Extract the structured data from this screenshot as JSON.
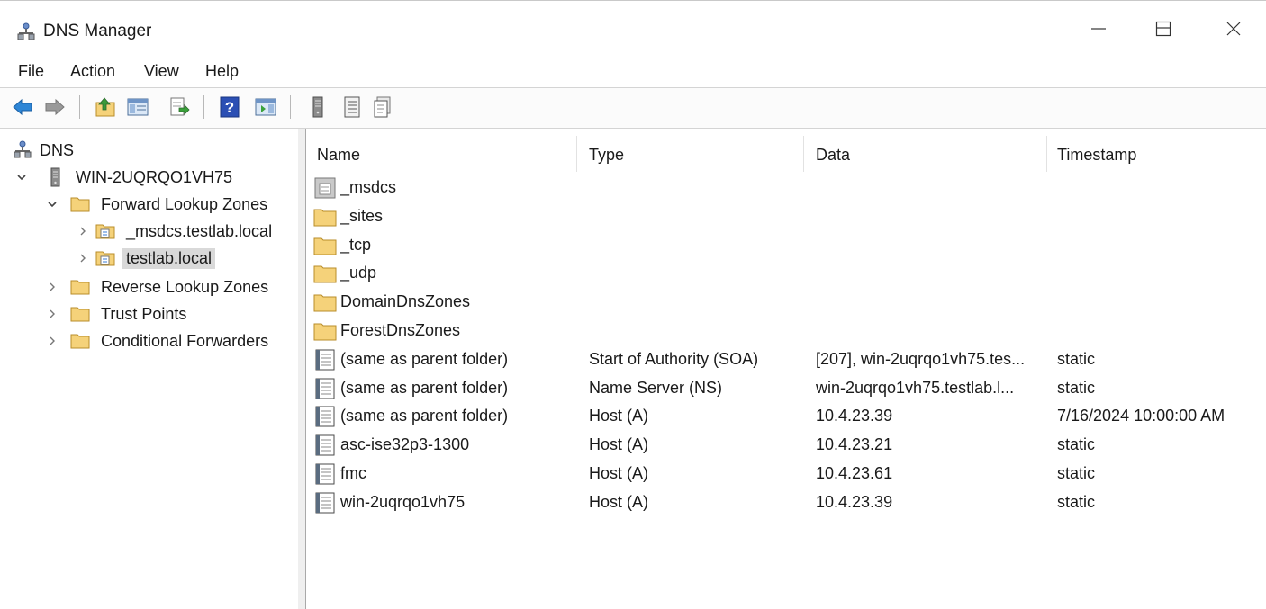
{
  "window": {
    "title": "DNS Manager",
    "icon": "dns-manager-icon",
    "controls": [
      "minimize-icon",
      "maximize-icon",
      "close-icon"
    ]
  },
  "menu": [
    "File",
    "Action",
    "View",
    "Help"
  ],
  "toolbar": [
    "back-arrow-icon",
    "forward-arrow-icon",
    "up-folder-icon",
    "show-hide-console-tree-icon",
    "export-list-icon",
    "help-icon",
    "action-pane-icon",
    "server-icon",
    "list-view-icon",
    "properties-icon"
  ],
  "tree": [
    {
      "label": "DNS",
      "icon": "dns-icon",
      "expander": "none",
      "level": 0
    },
    {
      "label": "WIN-2UQRQO1VH75",
      "icon": "server-icon",
      "expander": "expanded",
      "level": 1
    },
    {
      "label": "Forward Lookup Zones",
      "icon": "folder-icon",
      "expander": "expanded",
      "level": 2
    },
    {
      "label": "_msdcs.testlab.local",
      "icon": "zone-icon",
      "expander": "collapsed",
      "level": 3
    },
    {
      "label": "testlab.local",
      "icon": "zone-icon",
      "expander": "collapsed",
      "level": 3,
      "selected": true
    },
    {
      "label": "Reverse Lookup Zones",
      "icon": "folder-icon",
      "expander": "collapsed",
      "level": 2
    },
    {
      "label": "Trust Points",
      "icon": "folder-icon",
      "expander": "collapsed",
      "level": 2
    },
    {
      "label": "Conditional Forwarders",
      "icon": "folder-icon",
      "expander": "collapsed",
      "level": 2
    }
  ],
  "list": {
    "columns": [
      "Name",
      "Type",
      "Data",
      "Timestamp"
    ],
    "rows": [
      {
        "icon": "delegated-zone-icon",
        "name": "_msdcs",
        "type": "",
        "data": "",
        "timestamp": ""
      },
      {
        "icon": "folder-icon",
        "name": "_sites",
        "type": "",
        "data": "",
        "timestamp": ""
      },
      {
        "icon": "folder-icon",
        "name": "_tcp",
        "type": "",
        "data": "",
        "timestamp": ""
      },
      {
        "icon": "folder-icon",
        "name": "_udp",
        "type": "",
        "data": "",
        "timestamp": ""
      },
      {
        "icon": "folder-icon",
        "name": "DomainDnsZones",
        "type": "",
        "data": "",
        "timestamp": ""
      },
      {
        "icon": "folder-icon",
        "name": "ForestDnsZones",
        "type": "",
        "data": "",
        "timestamp": ""
      },
      {
        "icon": "record-icon",
        "name": "(same as parent folder)",
        "type": "Start of Authority (SOA)",
        "data": "[207], win-2uqrqo1vh75.tes...",
        "timestamp": "static"
      },
      {
        "icon": "record-icon",
        "name": "(same as parent folder)",
        "type": "Name Server (NS)",
        "data": "win-2uqrqo1vh75.testlab.l...",
        "timestamp": "static"
      },
      {
        "icon": "record-icon",
        "name": "(same as parent folder)",
        "type": "Host (A)",
        "data": "10.4.23.39",
        "timestamp": "7/16/2024 10:00:00 AM"
      },
      {
        "icon": "record-icon",
        "name": "asc-ise32p3-1300",
        "type": "Host (A)",
        "data": "10.4.23.21",
        "timestamp": "static"
      },
      {
        "icon": "record-icon",
        "name": "fmc",
        "type": "Host (A)",
        "data": "10.4.23.61",
        "timestamp": "static"
      },
      {
        "icon": "record-icon",
        "name": "win-2uqrqo1vh75",
        "type": "Host (A)",
        "data": "10.4.23.39",
        "timestamp": "static"
      }
    ]
  },
  "colors": {
    "selection": "#d9d9d9",
    "folder": "#f5d27a",
    "help_blue": "#2b4fb4",
    "arrow_blue": "#2e86d6"
  }
}
